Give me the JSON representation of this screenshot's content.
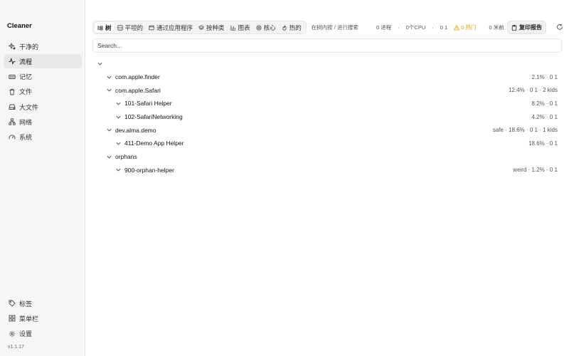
{
  "app": {
    "title": "Cleaner",
    "version": "v1.1.17"
  },
  "sidebar": {
    "items": [
      {
        "label": "干净的",
        "icon": "sparkles-icon"
      },
      {
        "label": "流程",
        "icon": "activity-icon",
        "active": true
      },
      {
        "label": "记忆",
        "icon": "memory-icon"
      },
      {
        "label": "文件",
        "icon": "trash-icon"
      },
      {
        "label": "大文件",
        "icon": "drive-icon"
      },
      {
        "label": "网络",
        "icon": "network-icon"
      },
      {
        "label": "系统",
        "icon": "gauge-icon"
      }
    ],
    "bottom": [
      {
        "label": "标签",
        "icon": "tag-icon"
      },
      {
        "label": "菜单栏",
        "icon": "grid-icon"
      },
      {
        "label": "设置",
        "icon": "gear-icon"
      }
    ]
  },
  "toolbar": {
    "view_tabs": [
      {
        "label": "树",
        "icon": "tree-icon",
        "active": true
      },
      {
        "label": "平坦的",
        "icon": "list-icon"
      },
      {
        "label": "通过应用程序",
        "icon": "window-icon"
      },
      {
        "label": "按种类",
        "icon": "layers-icon"
      },
      {
        "label": "图表",
        "icon": "chart-icon"
      },
      {
        "label": "核心",
        "icon": "cpu-icon"
      },
      {
        "label": "热的",
        "icon": "flame-icon"
      }
    ],
    "hint": "在树内按 / 进行搜索",
    "stats": {
      "processes": "0 进程",
      "cpu": "0个CPU",
      "load": "0 1",
      "hot": "0 热门",
      "age": "0 米前"
    },
    "copy_label": "复印报告",
    "colors": {
      "warning": "#e5a000"
    }
  },
  "search": {
    "placeholder": "Search..."
  },
  "tree": {
    "rows": [
      {
        "depth": 0,
        "name": "",
        "meta": ""
      },
      {
        "depth": 1,
        "name": "com.apple.finder",
        "meta": "2.1% · 0 1"
      },
      {
        "depth": 1,
        "name": "com.apple.Safari",
        "meta": "12.4% · 0 1 · 2 kids"
      },
      {
        "depth": 2,
        "name": "101-Safari Helper",
        "meta": "8.2% · 0 1"
      },
      {
        "depth": 2,
        "name": "102-SafariNetworking",
        "meta": "4.2% · 0 1"
      },
      {
        "depth": 1,
        "name": "dev.alma.demo",
        "meta": "safe · 18.6% · 0 1 · 1 kids"
      },
      {
        "depth": 2,
        "name": "411-Demo App Helper",
        "meta": "18.6% · 0 1"
      },
      {
        "depth": 1,
        "name": "orphans",
        "meta": ""
      },
      {
        "depth": 2,
        "name": "900-orphan-helper",
        "meta": "weird · 1.2% · 0 1"
      }
    ]
  }
}
